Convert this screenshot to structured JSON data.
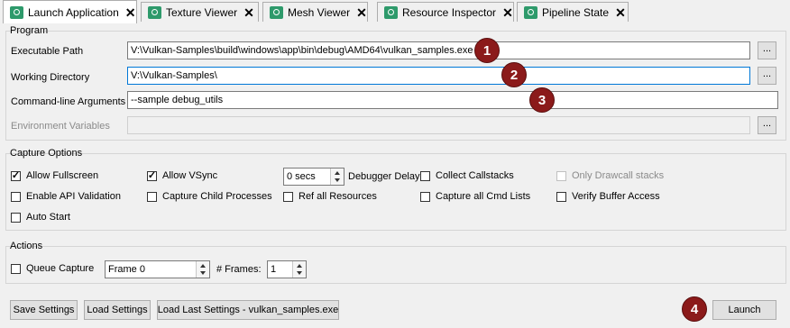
{
  "tabs": [
    {
      "label": "Launch Application",
      "active": true
    },
    {
      "label": "Texture Viewer"
    },
    {
      "label": "Mesh Viewer"
    },
    {
      "label": "Resource Inspector"
    },
    {
      "label": "Pipeline State"
    }
  ],
  "program": {
    "title": "Program",
    "executable_label": "Executable Path",
    "executable_value": "V:\\Vulkan-Samples\\build\\windows\\app\\bin\\debug\\AMD64\\vulkan_samples.exe",
    "working_dir_label": "Working Directory",
    "working_dir_value": "V:\\Vulkan-Samples\\",
    "args_label": "Command-line Arguments",
    "args_value": "--sample debug_utils",
    "env_label": "Environment Variables",
    "env_value": "",
    "browse_label": "..."
  },
  "capture": {
    "title": "Capture Options",
    "allow_fullscreen": "Allow Fullscreen",
    "allow_vsync": "Allow VSync",
    "debugger_delay_value": "0 secs",
    "debugger_delay_label": "Debugger Delay",
    "collect_callstacks": "Collect Callstacks",
    "only_drawcall_stacks": "Only Drawcall stacks",
    "enable_api_validation": "Enable API Validation",
    "capture_child_processes": "Capture Child Processes",
    "ref_all_resources": "Ref all Resources",
    "capture_all_cmd_lists": "Capture all Cmd Lists",
    "verify_buffer_access": "Verify Buffer Access",
    "auto_start": "Auto Start"
  },
  "actions": {
    "title": "Actions",
    "queue_capture": "Queue Capture",
    "frame_value": "Frame 0",
    "num_frames_label": "# Frames:",
    "num_frames_value": "1"
  },
  "buttons": {
    "save_settings": "Save Settings",
    "load_settings": "Load Settings",
    "load_last_settings": "Load Last Settings - vulkan_samples.exe",
    "launch": "Launch"
  },
  "markers": [
    "1",
    "2",
    "3",
    "4"
  ],
  "colors": {
    "accent": "#0078d7",
    "tab_icon": "#2e9a6b",
    "marker": "#8b1a1a"
  }
}
